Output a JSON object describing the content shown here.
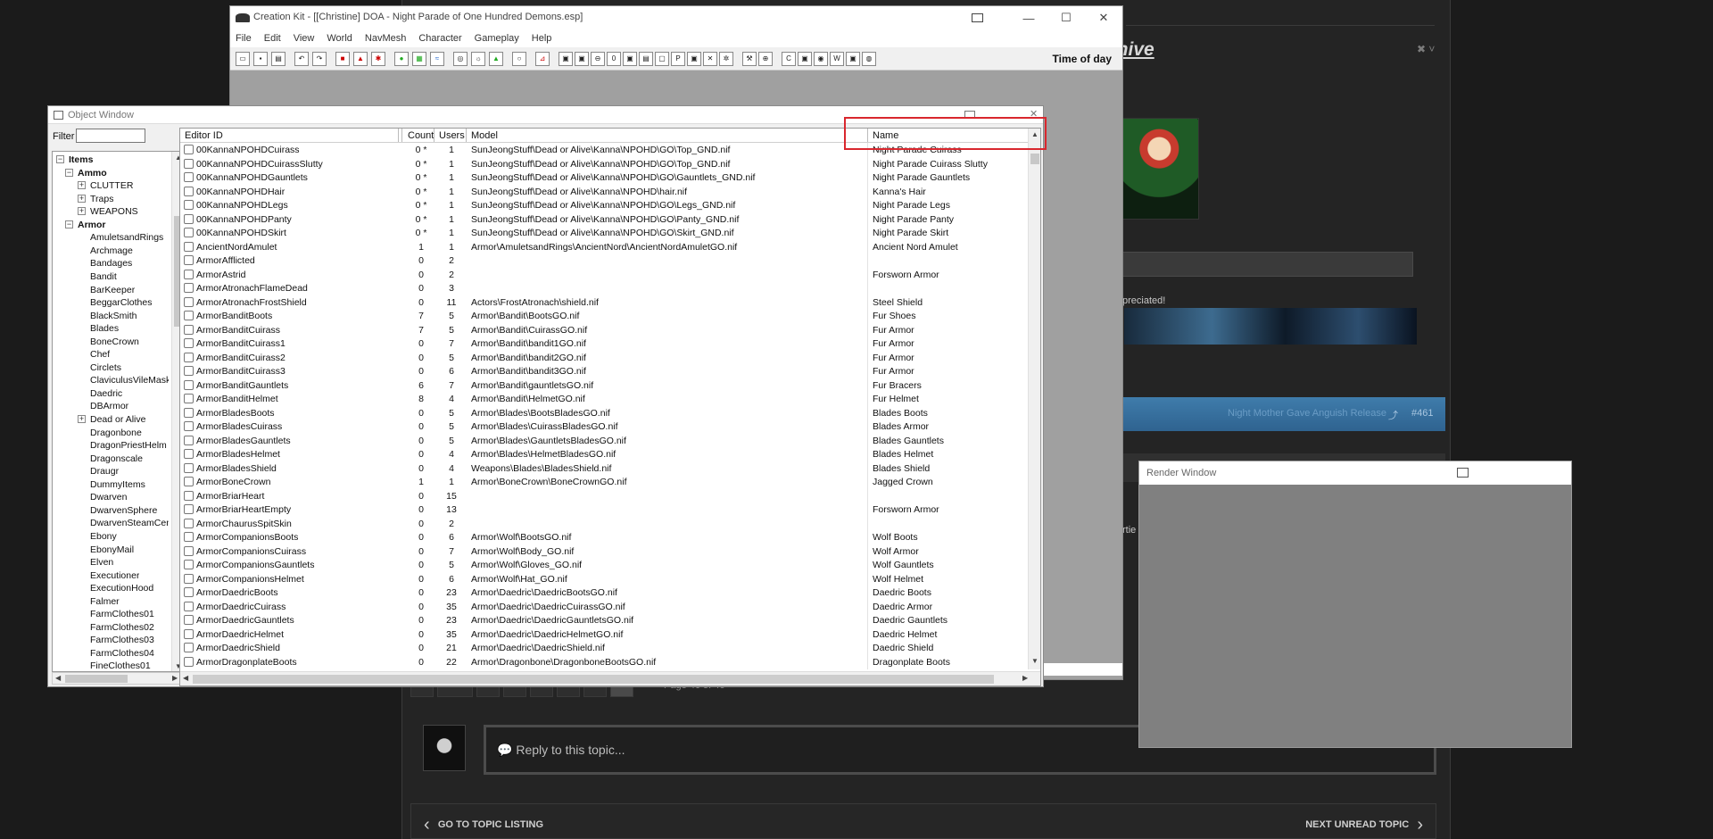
{
  "forum": {
    "title": "chive",
    "close_glyph": "✖ ˅",
    "appreciated": "preciated!",
    "blue_bar_text": "Night Mother Gave Anguish Release",
    "blue_bar_number": "#461",
    "partial_text": "rtie",
    "pagination_text": "Page 46 of 46",
    "reply_placeholder": "Reply to this topic...",
    "footer_left": "GO TO TOPIC LISTING",
    "footer_right": "NEXT UNREAD TOPIC"
  },
  "render_window": {
    "title": "Render Window"
  },
  "creation_kit": {
    "title": "Creation Kit - [[Christine] DOA - Night Parade of One Hundred Demons.esp]",
    "menus": [
      "File",
      "Edit",
      "View",
      "World",
      "NavMesh",
      "Character",
      "Gameplay",
      "Help"
    ],
    "time_of_day_label": "Time of day"
  },
  "object_window": {
    "title": "Object Window",
    "filter_label": "Filter",
    "filter_value": "",
    "tree": [
      {
        "label": "Items",
        "depth": 0,
        "bold": true,
        "expander": "−"
      },
      {
        "label": "Ammo",
        "depth": 1,
        "bold": true,
        "expander": "−"
      },
      {
        "label": "CLUTTER",
        "depth": 2,
        "bold": false,
        "expander": "+"
      },
      {
        "label": "Traps",
        "depth": 2,
        "bold": false,
        "expander": "+"
      },
      {
        "label": "WEAPONS",
        "depth": 2,
        "bold": false,
        "expander": "+"
      },
      {
        "label": "Armor",
        "depth": 1,
        "bold": true,
        "expander": "−"
      },
      {
        "label": "AmuletsandRings",
        "depth": 2,
        "bold": false,
        "expander": ""
      },
      {
        "label": "Archmage",
        "depth": 2,
        "bold": false,
        "expander": ""
      },
      {
        "label": "Bandages",
        "depth": 2,
        "bold": false,
        "expander": ""
      },
      {
        "label": "Bandit",
        "depth": 2,
        "bold": false,
        "expander": ""
      },
      {
        "label": "BarKeeper",
        "depth": 2,
        "bold": false,
        "expander": ""
      },
      {
        "label": "BeggarClothes",
        "depth": 2,
        "bold": false,
        "expander": ""
      },
      {
        "label": "BlackSmith",
        "depth": 2,
        "bold": false,
        "expander": ""
      },
      {
        "label": "Blades",
        "depth": 2,
        "bold": false,
        "expander": ""
      },
      {
        "label": "BoneCrown",
        "depth": 2,
        "bold": false,
        "expander": ""
      },
      {
        "label": "Chef",
        "depth": 2,
        "bold": false,
        "expander": ""
      },
      {
        "label": "Circlets",
        "depth": 2,
        "bold": false,
        "expander": ""
      },
      {
        "label": "ClaviculusVileMask",
        "depth": 2,
        "bold": false,
        "expander": ""
      },
      {
        "label": "Daedric",
        "depth": 2,
        "bold": false,
        "expander": ""
      },
      {
        "label": "DBArmor",
        "depth": 2,
        "bold": false,
        "expander": ""
      },
      {
        "label": "Dead or Alive",
        "depth": 2,
        "bold": false,
        "expander": "+"
      },
      {
        "label": "Dragonbone",
        "depth": 2,
        "bold": false,
        "expander": ""
      },
      {
        "label": "DragonPriestHelm",
        "depth": 2,
        "bold": false,
        "expander": ""
      },
      {
        "label": "Dragonscale",
        "depth": 2,
        "bold": false,
        "expander": ""
      },
      {
        "label": "Draugr",
        "depth": 2,
        "bold": false,
        "expander": ""
      },
      {
        "label": "DummyItems",
        "depth": 2,
        "bold": false,
        "expander": ""
      },
      {
        "label": "Dwarven",
        "depth": 2,
        "bold": false,
        "expander": ""
      },
      {
        "label": "DwarvenSphere",
        "depth": 2,
        "bold": false,
        "expander": ""
      },
      {
        "label": "DwarvenSteamCenturion",
        "depth": 2,
        "bold": false,
        "expander": ""
      },
      {
        "label": "Ebony",
        "depth": 2,
        "bold": false,
        "expander": ""
      },
      {
        "label": "EbonyMail",
        "depth": 2,
        "bold": false,
        "expander": ""
      },
      {
        "label": "Elven",
        "depth": 2,
        "bold": false,
        "expander": ""
      },
      {
        "label": "Executioner",
        "depth": 2,
        "bold": false,
        "expander": ""
      },
      {
        "label": "ExecutionHood",
        "depth": 2,
        "bold": false,
        "expander": ""
      },
      {
        "label": "Falmer",
        "depth": 2,
        "bold": false,
        "expander": ""
      },
      {
        "label": "FarmClothes01",
        "depth": 2,
        "bold": false,
        "expander": ""
      },
      {
        "label": "FarmClothes02",
        "depth": 2,
        "bold": false,
        "expander": ""
      },
      {
        "label": "FarmClothes03",
        "depth": 2,
        "bold": false,
        "expander": ""
      },
      {
        "label": "FarmClothes04",
        "depth": 2,
        "bold": false,
        "expander": ""
      },
      {
        "label": "FineClothes01",
        "depth": 2,
        "bold": false,
        "expander": ""
      }
    ],
    "columns": [
      "Editor ID",
      "Count",
      "Users",
      "Model",
      "Name"
    ],
    "rows": [
      [
        "00KannaNPOHDCuirass",
        "0 *",
        "1",
        "SunJeongStuff\\Dead or Alive\\Kanna\\NPOHD\\GO\\Top_GND.nif",
        "Night Parade Cuirass"
      ],
      [
        "00KannaNPOHDCuirassSlutty",
        "0 *",
        "1",
        "SunJeongStuff\\Dead or Alive\\Kanna\\NPOHD\\GO\\Top_GND.nif",
        "Night Parade Cuirass Slutty"
      ],
      [
        "00KannaNPOHDGauntlets",
        "0 *",
        "1",
        "SunJeongStuff\\Dead or Alive\\Kanna\\NPOHD\\GO\\Gauntlets_GND.nif",
        "Night Parade Gauntlets"
      ],
      [
        "00KannaNPOHDHair",
        "0 *",
        "1",
        "SunJeongStuff\\Dead or Alive\\Kanna\\NPOHD\\hair.nif",
        "Kanna's Hair"
      ],
      [
        "00KannaNPOHDLegs",
        "0 *",
        "1",
        "SunJeongStuff\\Dead or Alive\\Kanna\\NPOHD\\GO\\Legs_GND.nif",
        "Night Parade Legs"
      ],
      [
        "00KannaNPOHDPanty",
        "0 *",
        "1",
        "SunJeongStuff\\Dead or Alive\\Kanna\\NPOHD\\GO\\Panty_GND.nif",
        "Night Parade Panty"
      ],
      [
        "00KannaNPOHDSkirt",
        "0 *",
        "1",
        "SunJeongStuff\\Dead or Alive\\Kanna\\NPOHD\\GO\\Skirt_GND.nif",
        "Night Parade Skirt"
      ],
      [
        "AncientNordAmulet",
        "1",
        "1",
        "Armor\\AmuletsandRings\\AncientNord\\AncientNordAmuletGO.nif",
        "Ancient Nord Amulet"
      ],
      [
        "ArmorAfflicted",
        "0",
        "2",
        "",
        ""
      ],
      [
        "ArmorAstrid",
        "0",
        "2",
        "",
        "Forsworn Armor"
      ],
      [
        "ArmorAtronachFlameDead",
        "0",
        "3",
        "",
        ""
      ],
      [
        "ArmorAtronachFrostShield",
        "0",
        "11",
        "Actors\\FrostAtronach\\shield.nif",
        "Steel Shield"
      ],
      [
        "ArmorBanditBoots",
        "7",
        "5",
        "Armor\\Bandit\\BootsGO.nif",
        "Fur Shoes"
      ],
      [
        "ArmorBanditCuirass",
        "7",
        "5",
        "Armor\\Bandit\\CuirassGO.nif",
        "Fur Armor"
      ],
      [
        "ArmorBanditCuirass1",
        "0",
        "7",
        "Armor\\Bandit\\bandit1GO.nif",
        "Fur Armor"
      ],
      [
        "ArmorBanditCuirass2",
        "0",
        "5",
        "Armor\\Bandit\\bandit2GO.nif",
        "Fur Armor"
      ],
      [
        "ArmorBanditCuirass3",
        "0",
        "6",
        "Armor\\Bandit\\bandit3GO.nif",
        "Fur Armor"
      ],
      [
        "ArmorBanditGauntlets",
        "6",
        "7",
        "Armor\\Bandit\\gauntletsGO.nif",
        "Fur Bracers"
      ],
      [
        "ArmorBanditHelmet",
        "8",
        "4",
        "Armor\\Bandit\\HelmetGO.nif",
        "Fur Helmet"
      ],
      [
        "ArmorBladesBoots",
        "0",
        "5",
        "Armor\\Blades\\BootsBladesGO.nif",
        "Blades Boots"
      ],
      [
        "ArmorBladesCuirass",
        "0",
        "5",
        "Armor\\Blades\\CuirassBladesGO.nif",
        "Blades Armor"
      ],
      [
        "ArmorBladesGauntlets",
        "0",
        "5",
        "Armor\\Blades\\GauntletsBladesGO.nif",
        "Blades Gauntlets"
      ],
      [
        "ArmorBladesHelmet",
        "0",
        "4",
        "Armor\\Blades\\HelmetBladesGO.nif",
        "Blades Helmet"
      ],
      [
        "ArmorBladesShield",
        "0",
        "4",
        "Weapons\\Blades\\BladesShield.nif",
        "Blades Shield"
      ],
      [
        "ArmorBoneCrown",
        "1",
        "1",
        "Armor\\BoneCrown\\BoneCrownGO.nif",
        "Jagged Crown"
      ],
      [
        "ArmorBriarHeart",
        "0",
        "15",
        "",
        ""
      ],
      [
        "ArmorBriarHeartEmpty",
        "0",
        "13",
        "",
        "Forsworn Armor"
      ],
      [
        "ArmorChaurusSpitSkin",
        "0",
        "2",
        "",
        ""
      ],
      [
        "ArmorCompanionsBoots",
        "0",
        "6",
        "Armor\\Wolf\\BootsGO.nif",
        "Wolf Boots"
      ],
      [
        "ArmorCompanionsCuirass",
        "0",
        "7",
        "Armor\\Wolf\\Body_GO.nif",
        "Wolf Armor"
      ],
      [
        "ArmorCompanionsGauntlets",
        "0",
        "5",
        "Armor\\Wolf\\Gloves_GO.nif",
        "Wolf Gauntlets"
      ],
      [
        "ArmorCompanionsHelmet",
        "0",
        "6",
        "Armor\\Wolf\\Hat_GO.nif",
        "Wolf Helmet"
      ],
      [
        "ArmorDaedricBoots",
        "0",
        "23",
        "Armor\\Daedric\\DaedricBootsGO.nif",
        "Daedric Boots"
      ],
      [
        "ArmorDaedricCuirass",
        "0",
        "35",
        "Armor\\Daedric\\DaedricCuirassGO.nif",
        "Daedric Armor"
      ],
      [
        "ArmorDaedricGauntlets",
        "0",
        "23",
        "Armor\\Daedric\\DaedricGauntletsGO.nif",
        "Daedric Gauntlets"
      ],
      [
        "ArmorDaedricHelmet",
        "0",
        "35",
        "Armor\\Daedric\\DaedricHelmetGO.nif",
        "Daedric Helmet"
      ],
      [
        "ArmorDaedricShield",
        "0",
        "21",
        "Armor\\Daedric\\DaedricShield.nif",
        "Daedric Shield"
      ],
      [
        "ArmorDragonplateBoots",
        "0",
        "22",
        "Armor\\Dragonbone\\DragonboneBootsGO.nif",
        "Dragonplate Boots"
      ]
    ]
  }
}
